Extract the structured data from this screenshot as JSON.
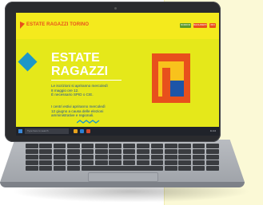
{
  "site": {
    "logo_text": "ESTATE RAGAZZI TORINO",
    "nav": [
      "ISCRIZIONI",
      "REGOLAMENTO",
      "INFO"
    ],
    "hero": {
      "title_line1": "ESTATE",
      "title_line2": "RAGAZZI",
      "paragraph1": "Le iscrizioni si apriranno mercoledì\n8 maggio ore 12.\nÈ necessario SPID o CIE.",
      "paragraph2": "I centri estivi apriranno mercoledì\n12 giugno a causa delle elezioni\namministrative e regionali."
    },
    "colors": {
      "yellow": "#e5e81a",
      "orange": "#e8501c",
      "blue": "#1d55a8",
      "cyan": "#1d97c8"
    }
  },
  "taskbar": {
    "search_placeholder": "Type here to search",
    "tray_text": "11:24"
  }
}
